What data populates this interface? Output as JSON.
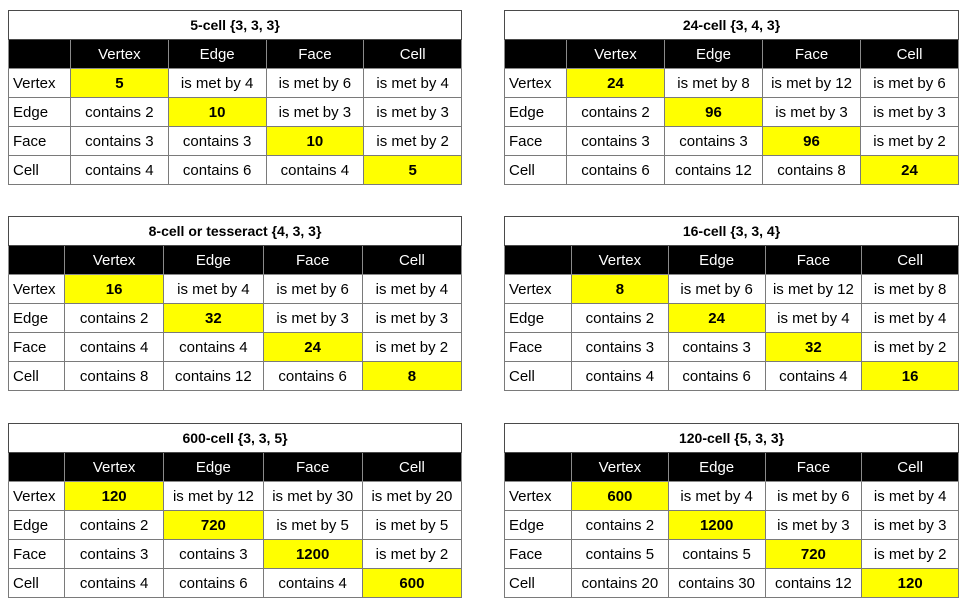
{
  "columns": [
    "Vertex",
    "Edge",
    "Face",
    "Cell"
  ],
  "highlight_color": "#ffff00",
  "tables": [
    {
      "title": "5-cell {3, 3, 3}",
      "rows": [
        {
          "label": "Vertex",
          "cells": [
            "5",
            "is met by 4",
            "is met by 6",
            "is met by 4"
          ]
        },
        {
          "label": "Edge",
          "cells": [
            "contains 2",
            "10",
            "is met by 3",
            "is met by 3"
          ]
        },
        {
          "label": "Face",
          "cells": [
            "contains 3",
            "contains 3",
            "10",
            "is met by 2"
          ]
        },
        {
          "label": "Cell",
          "cells": [
            "contains 4",
            "contains 6",
            "contains 4",
            "5"
          ]
        }
      ]
    },
    {
      "title": "24-cell {3, 4, 3}",
      "rows": [
        {
          "label": "Vertex",
          "cells": [
            "24",
            "is met by 8",
            "is met by 12",
            "is met by 6"
          ]
        },
        {
          "label": "Edge",
          "cells": [
            "contains 2",
            "96",
            "is met by 3",
            "is met by 3"
          ]
        },
        {
          "label": "Face",
          "cells": [
            "contains 3",
            "contains 3",
            "96",
            "is met by 2"
          ]
        },
        {
          "label": "Cell",
          "cells": [
            "contains 6",
            "contains 12",
            "contains 8",
            "24"
          ]
        }
      ]
    },
    {
      "title": "8-cell or tesseract {4, 3, 3}",
      "rows": [
        {
          "label": "Vertex",
          "cells": [
            "16",
            "is met by 4",
            "is met by 6",
            "is met by 4"
          ]
        },
        {
          "label": "Edge",
          "cells": [
            "contains 2",
            "32",
            "is met by 3",
            "is met by 3"
          ]
        },
        {
          "label": "Face",
          "cells": [
            "contains 4",
            "contains 4",
            "24",
            "is met by 2"
          ]
        },
        {
          "label": "Cell",
          "cells": [
            "contains 8",
            "contains 12",
            "contains 6",
            "8"
          ]
        }
      ]
    },
    {
      "title": "16-cell {3, 3, 4}",
      "rows": [
        {
          "label": "Vertex",
          "cells": [
            "8",
            "is met by 6",
            "is met by 12",
            "is met by 8"
          ]
        },
        {
          "label": "Edge",
          "cells": [
            "contains 2",
            "24",
            "is met by 4",
            "is met by 4"
          ]
        },
        {
          "label": "Face",
          "cells": [
            "contains 3",
            "contains 3",
            "32",
            "is met by 2"
          ]
        },
        {
          "label": "Cell",
          "cells": [
            "contains 4",
            "contains 6",
            "contains 4",
            "16"
          ]
        }
      ]
    },
    {
      "title": "600-cell {3, 3, 5}",
      "rows": [
        {
          "label": "Vertex",
          "cells": [
            "120",
            "is met by 12",
            "is met by 30",
            "is met by 20"
          ]
        },
        {
          "label": "Edge",
          "cells": [
            "contains 2",
            "720",
            "is met by 5",
            "is met by 5"
          ]
        },
        {
          "label": "Face",
          "cells": [
            "contains 3",
            "contains 3",
            "1200",
            "is met by 2"
          ]
        },
        {
          "label": "Cell",
          "cells": [
            "contains 4",
            "contains 6",
            "contains 4",
            "600"
          ]
        }
      ]
    },
    {
      "title": "120-cell {5, 3, 3}",
      "rows": [
        {
          "label": "Vertex",
          "cells": [
            "600",
            "is met by 4",
            "is met by 6",
            "is met by 4"
          ]
        },
        {
          "label": "Edge",
          "cells": [
            "contains 2",
            "1200",
            "is met by 3",
            "is met by 3"
          ]
        },
        {
          "label": "Face",
          "cells": [
            "contains 5",
            "contains 5",
            "720",
            "is met by 2"
          ]
        },
        {
          "label": "Cell",
          "cells": [
            "contains 20",
            "contains 30",
            "contains 12",
            "120"
          ]
        }
      ]
    }
  ]
}
